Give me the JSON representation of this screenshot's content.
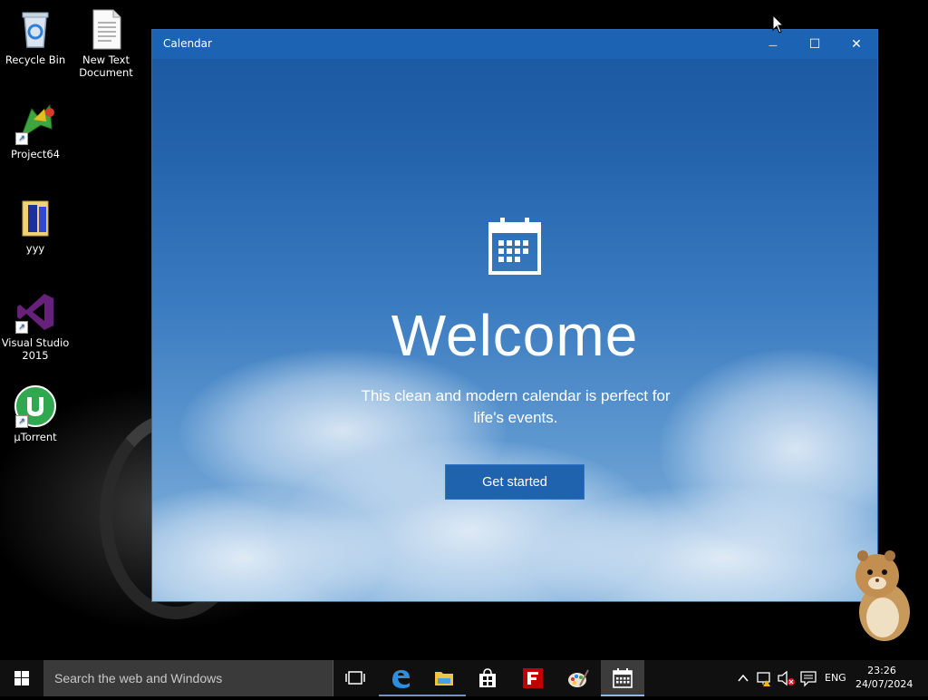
{
  "desktop": {
    "icons": [
      {
        "label": "Recycle Bin",
        "icon": "recycle-bin-icon"
      },
      {
        "label": "New Text\nDocument",
        "icon": "text-document-icon"
      },
      {
        "label": "Project64",
        "icon": "project64-icon"
      },
      {
        "label": "yyy",
        "icon": "folder-icon"
      },
      {
        "label": "Visual Studio\n2015",
        "icon": "visual-studio-icon"
      },
      {
        "label": "µTorrent",
        "icon": "utorrent-icon"
      }
    ]
  },
  "window": {
    "title": "Calendar",
    "minimize_glyph": "—",
    "maximize_glyph": "☐",
    "close_glyph": "✕"
  },
  "welcome": {
    "heading": "Welcome",
    "tagline": "This clean and modern calendar is perfect for life's events.",
    "button_label": "Get started"
  },
  "taskbar": {
    "search_placeholder": "Search the web and Windows",
    "apps": [
      {
        "name": "task-view",
        "icon": "task-view-icon"
      },
      {
        "name": "edge",
        "icon": "edge-icon"
      },
      {
        "name": "file-explorer",
        "icon": "folder-icon"
      },
      {
        "name": "store",
        "icon": "store-icon"
      },
      {
        "name": "filezilla",
        "icon": "filezilla-icon"
      },
      {
        "name": "paint",
        "icon": "paint-icon"
      },
      {
        "name": "calendar",
        "icon": "calendar-icon"
      }
    ],
    "language": "ENG",
    "time": "23:26",
    "date": "24/07/2024"
  },
  "colors": {
    "accent": "#1c63b3",
    "taskbar": "#101010"
  }
}
